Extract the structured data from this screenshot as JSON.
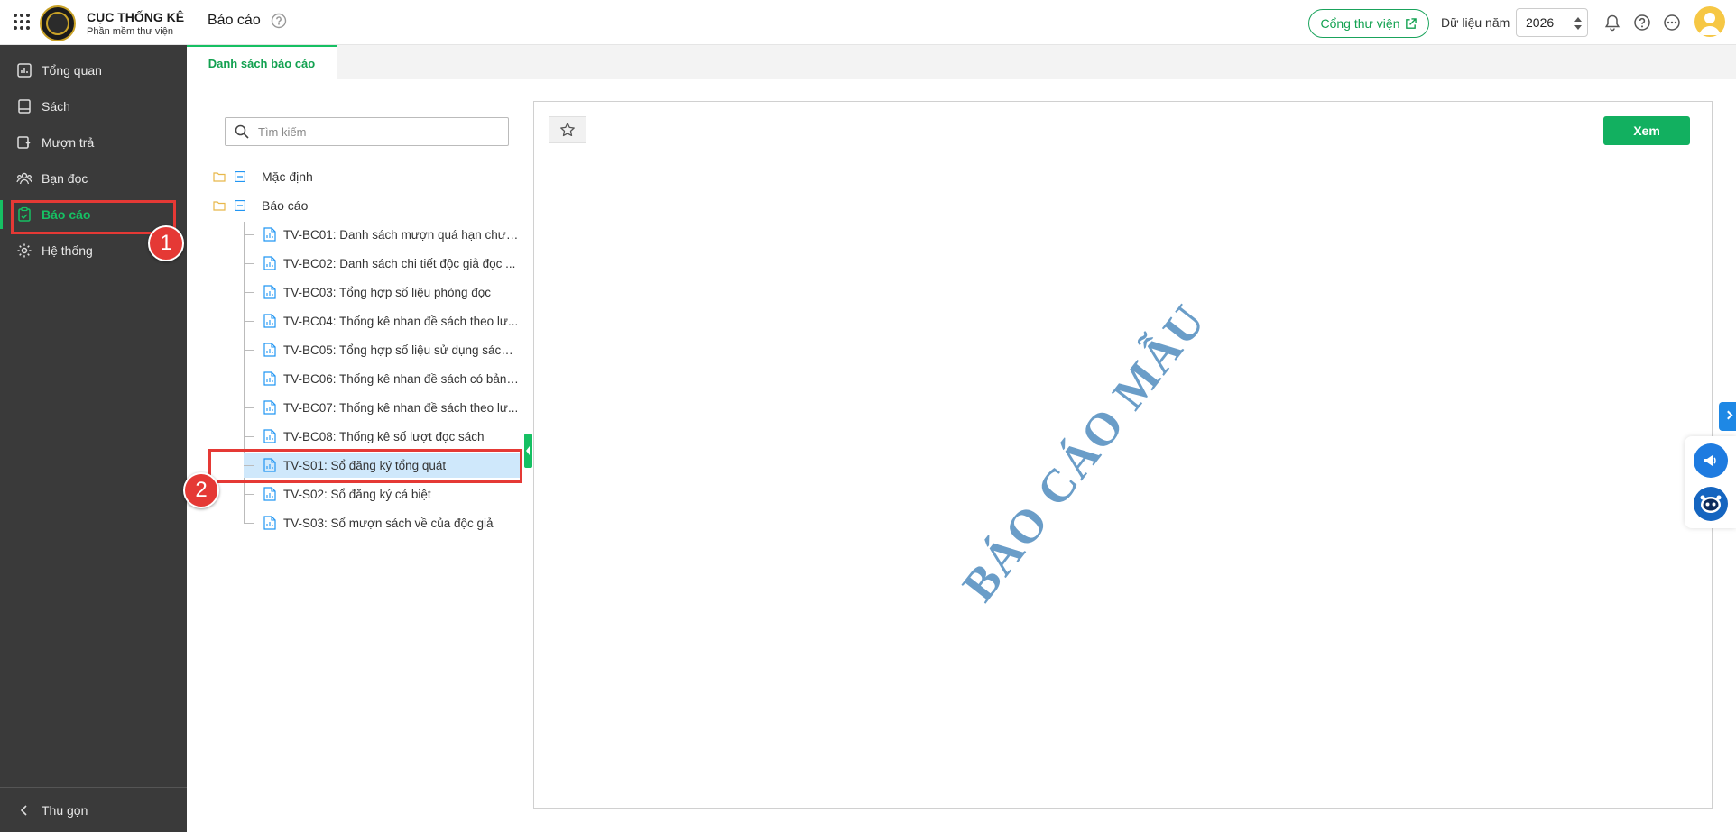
{
  "header": {
    "brand_title": "CỤC THỐNG KÊ",
    "brand_subtitle": "Phần mềm thư viện",
    "page_title": "Báo cáo",
    "portal_label": "Cổng thư viện",
    "year_label": "Dữ liệu năm",
    "year_value": "2026"
  },
  "sidebar": {
    "items": [
      {
        "label": "Tổng quan",
        "icon": "chart-icon"
      },
      {
        "label": "Sách",
        "icon": "book-icon"
      },
      {
        "label": "Mượn trả",
        "icon": "borrow-icon"
      },
      {
        "label": "Bạn đọc",
        "icon": "users-icon"
      },
      {
        "label": "Báo cáo",
        "icon": "clipboard-icon",
        "active": true
      },
      {
        "label": "Hệ thống",
        "icon": "gear-icon"
      }
    ],
    "collapse_label": "Thu gọn"
  },
  "tabs": [
    {
      "label": "Danh sách báo cáo",
      "active": true
    }
  ],
  "search": {
    "placeholder": "Tìm kiếm"
  },
  "tree": {
    "folders": [
      {
        "label": "Mặc định"
      },
      {
        "label": "Báo cáo"
      }
    ],
    "items": [
      {
        "label": "TV-BC01: Danh sách mượn quá hạn chưa ..."
      },
      {
        "label": "TV-BC02: Danh sách chi tiết độc giả đọc ..."
      },
      {
        "label": "TV-BC03: Tổng hợp số liệu phòng đọc"
      },
      {
        "label": "TV-BC04: Thống kê nhan đề sách theo lư..."
      },
      {
        "label": "TV-BC05: Tổng hợp số liệu sử dụng sách ..."
      },
      {
        "label": "TV-BC06: Thống kê nhan đề sách có bản ..."
      },
      {
        "label": "TV-BC07: Thống kê nhan đề sách theo lư..."
      },
      {
        "label": "TV-BC08: Thống kê số lượt đọc sách"
      },
      {
        "label": "TV-S01: Sổ đăng ký tổng quát",
        "selected": true
      },
      {
        "label": "TV-S02: Sổ đăng ký cá biệt"
      },
      {
        "label": "TV-S03: Sổ mượn sách về của độc giả"
      }
    ]
  },
  "preview": {
    "view_button": "Xem",
    "watermark": "BÁO CÁO MẪU"
  },
  "annotations": {
    "badge_1": "1",
    "badge_2": "2"
  },
  "colors": {
    "accent": "#16c063",
    "sidebar_bg": "#3a3a3a",
    "selected_bg": "#cfe8fb",
    "annotation": "#e53935",
    "watermark": "#6a9dc8"
  }
}
